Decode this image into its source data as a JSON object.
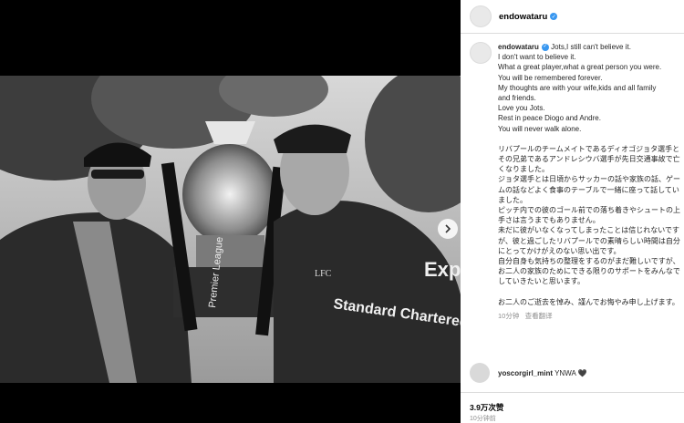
{
  "post": {
    "username": "endowataru",
    "verified_icon": "verified-badge-icon",
    "caption_first": "Jots,I still can't believe it.",
    "caption_lines": [
      "I don't want to believe it.",
      "What a great player,what a great person you were.",
      "You will be remembered forever.",
      "My thoughts are with your wife,kids and all family",
      "and friends.",
      "Love you Jots.",
      "Rest in peace Diogo and Andre.",
      "You will never walk alone."
    ],
    "caption_jp": [
      "リバプールのチームメイトであるディオゴジョタ選手とその兄弟であるアンドレシウバ選手が先日交通事故で亡くなりました。",
      "ジョタ選手とは日頃からサッカーの話や家族の話、ゲームの話などよく食事のテーブルで一緒に座って話していました。",
      "ピッチ内での彼のゴール前での落ち着きやシュートの上手さは言うまでもありません。",
      "未だに彼がいなくなってしまったことは信じれないですが、彼と過ごしたリバプールでの素晴らしい時間は自分にとってかけがえのない思い出です。",
      "自分自身も気持ちの整理をするのがまだ難しいですが、お二人の家族のためにできる限りのサポートをみんなでしていきたいと思います。"
    ],
    "caption_jp_end": "お二人のご逝去を悼み、謹んでお悔やみ申し上げます。",
    "caption_time": "10分钟",
    "translate_label": "查看翻译",
    "comment_user": "yoscorgirl_mint",
    "comment_text": "YNWA 🖤",
    "likes": "3.9万次赞",
    "time": "10分钟前"
  },
  "photo": {
    "trophy_text": "Premier League",
    "shirt_sponsor": "Standard Chartered",
    "expedia": "Expe",
    "lfc": "LFC"
  }
}
